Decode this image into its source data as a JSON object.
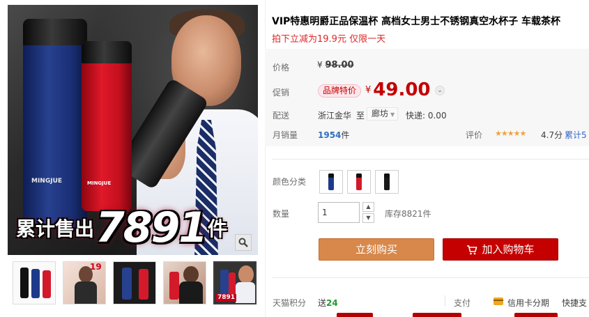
{
  "product": {
    "title": "VIP特惠明爵正品保温杯 高档女士男士不锈钢真空水杯子 车载茶杯",
    "subtitle": "拍下立减为19.9元 仅限一天"
  },
  "main_image": {
    "banner_prefix": "累计售出",
    "banner_number": "7891",
    "banner_suffix": "件",
    "bottle_brand": "MINGJUE"
  },
  "thumbnails": [
    {
      "tag": ""
    },
    {
      "tag": "19"
    },
    {
      "tag": ""
    },
    {
      "tag": ""
    },
    {
      "tag": "7891"
    }
  ],
  "price": {
    "label": "价格",
    "currency": "¥",
    "original": "98.00"
  },
  "promo": {
    "label": "促销",
    "badge": "品牌特价",
    "currency": "¥",
    "price": "49.00"
  },
  "shipping": {
    "label": "配送",
    "from": "浙江金华",
    "to_word": "至",
    "destination": "廊坊",
    "express": "快递: 0.00"
  },
  "sales": {
    "label": "月销量",
    "count": "1954",
    "unit": "件",
    "rating_label": "评价",
    "stars": "★★★★★",
    "score": "4.7分",
    "total_eval": "累计5"
  },
  "sku": {
    "color_label": "颜色分类",
    "swatches": [
      {
        "color": "#1e3a8a"
      },
      {
        "color": "#d21a2a"
      },
      {
        "color": "#1a1a1a"
      }
    ]
  },
  "quantity": {
    "label": "数量",
    "value": "1",
    "stock": "库存8821件"
  },
  "actions": {
    "buy_now": "立刻购买",
    "add_to_cart": "加入购物车"
  },
  "services": {
    "points_label": "天猫积分",
    "points_prefix": "送",
    "points_value": "24",
    "pay_label": "支付",
    "credit_card": "信用卡分期",
    "quick_pay": "快捷支"
  },
  "colors": {
    "accent_red": "#c40000",
    "buy_orange": "#d7884a"
  }
}
